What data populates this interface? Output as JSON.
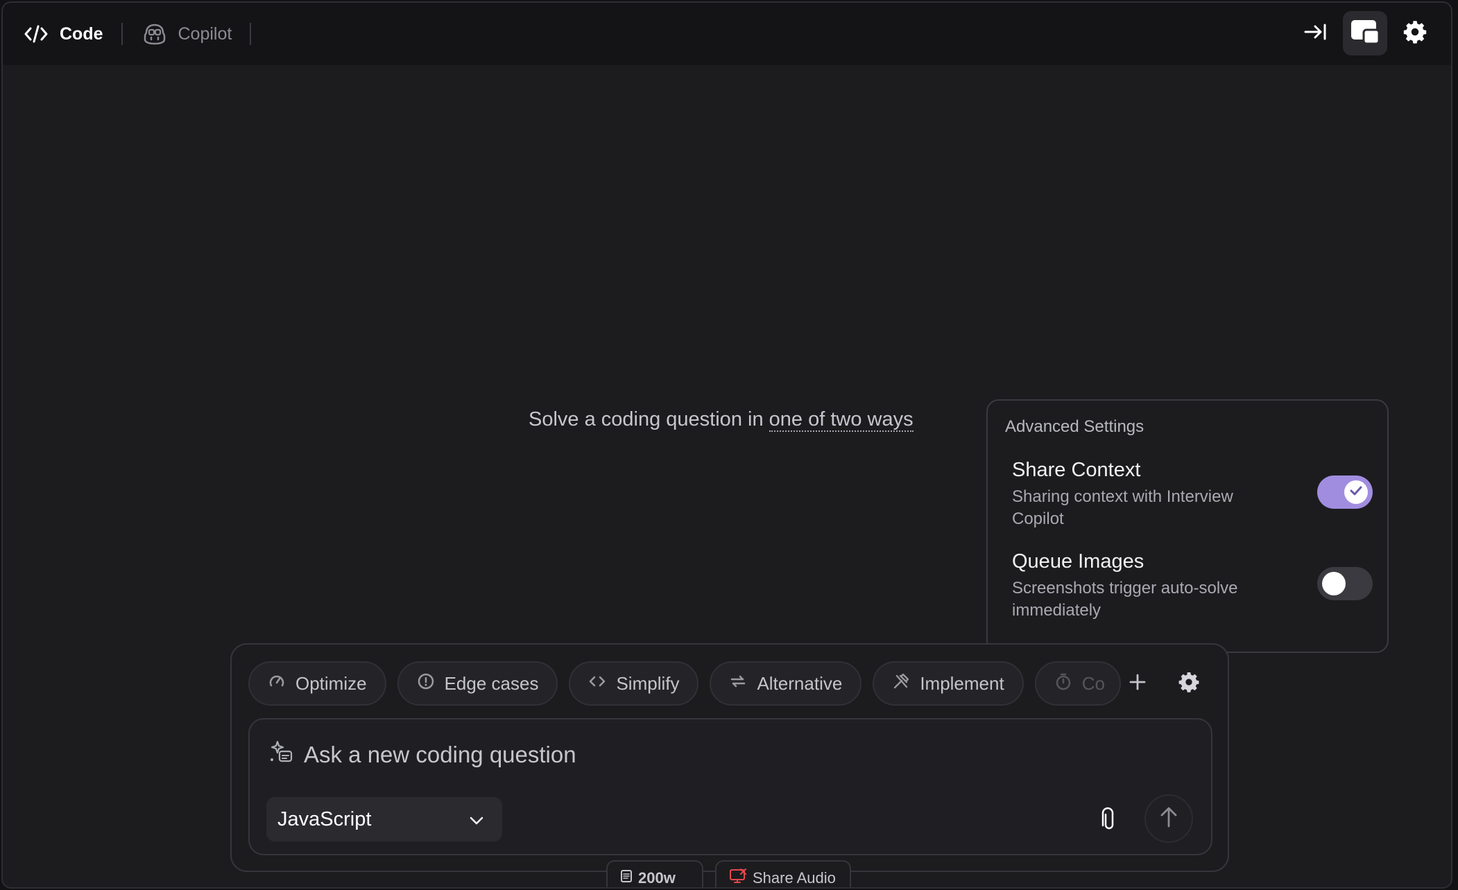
{
  "topbar": {
    "tabs": [
      {
        "label": "Code",
        "icon": "code-icon",
        "active": true
      },
      {
        "label": "Copilot",
        "icon": "copilot-icon",
        "active": false
      }
    ],
    "actions": [
      "collapse-right-icon",
      "overlay-window-icon",
      "gear-icon"
    ]
  },
  "main": {
    "hint_prefix": "Solve a coding question in",
    "hint_link": "one of two ways"
  },
  "advanced_settings": {
    "title": "Advanced Settings",
    "items": [
      {
        "title": "Share Context",
        "description": "Sharing context with Interview Copilot",
        "enabled": true
      },
      {
        "title": "Queue Images",
        "description": "Screenshots trigger auto-solve immediately",
        "enabled": false
      }
    ]
  },
  "composer": {
    "chips": [
      {
        "label": "Optimize",
        "icon": "gauge-icon"
      },
      {
        "label": "Edge cases",
        "icon": "alert-circle-icon"
      },
      {
        "label": "Simplify",
        "icon": "code-brackets-icon"
      },
      {
        "label": "Alternative",
        "icon": "swap-arrows-icon"
      },
      {
        "label": "Implement",
        "icon": "tools-icon"
      },
      {
        "label": "Co",
        "icon": "timer-icon"
      }
    ],
    "placeholder": "Ask a new coding question",
    "language": "JavaScript"
  },
  "bottom": {
    "word_limit": "200w",
    "share_audio": "Share Audio"
  },
  "colors": {
    "accent": "#a18de0",
    "background": "#1c1c1f",
    "topbar": "#141417",
    "share_audio_icon": "#e5484d"
  }
}
